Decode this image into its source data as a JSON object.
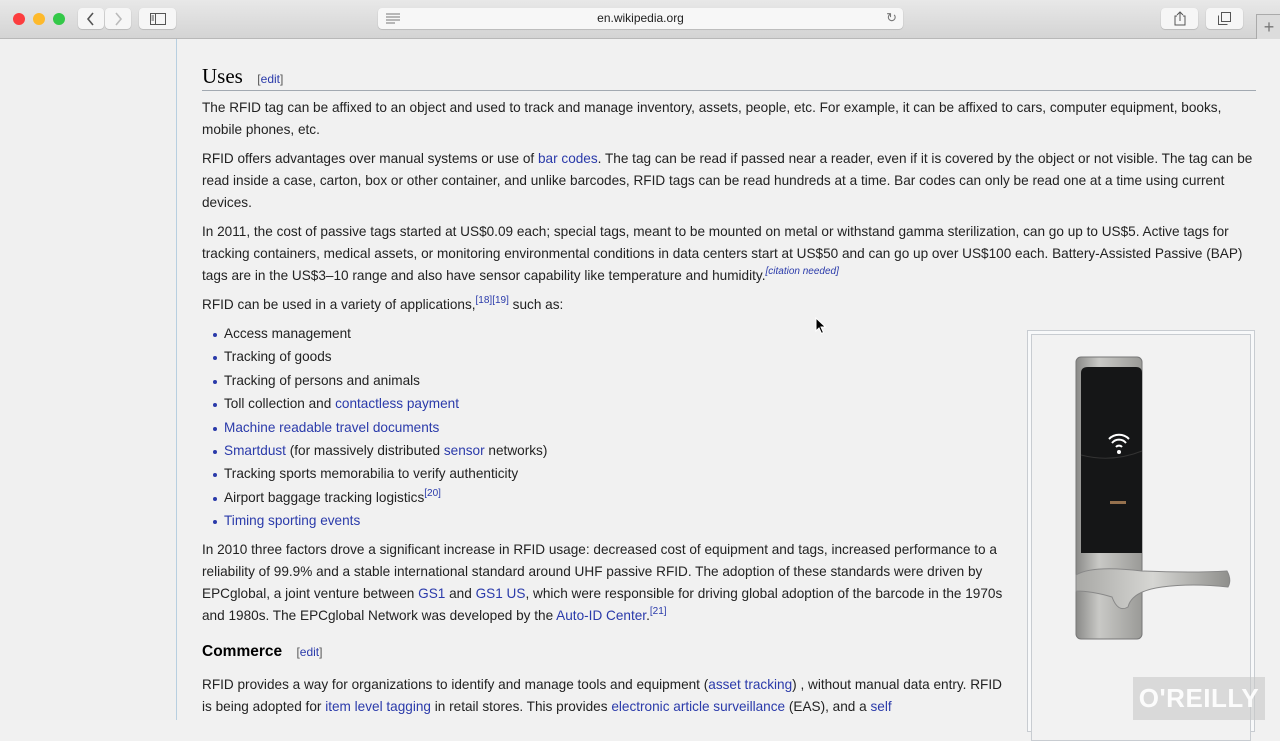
{
  "browser": {
    "url": "en.wikipedia.org",
    "icons": {
      "back": "chevron-left-icon",
      "forward": "chevron-right-icon",
      "sidebar": "sidebar-icon",
      "reader": "reader-icon",
      "reload": "reload-icon",
      "share": "share-icon",
      "tabs": "tabs-icon",
      "new_tab": "plus-icon"
    }
  },
  "article": {
    "uses": {
      "heading": "Uses",
      "edit": "edit",
      "p1": "The RFID tag can be affixed to an object and used to track and manage inventory, assets, people, etc. For example, it can be affixed to cars, computer equipment, books, mobile phones, etc.",
      "p2_a": "RFID offers advantages over manual systems or use of ",
      "p2_link": "bar codes",
      "p2_b": ". The tag can be read if passed near a reader, even if it is covered by the object or not visible. The tag can be read inside a case, carton, box or other container, and unlike barcodes, RFID tags can be read hundreds at a time. Bar codes can only be read one at a time using current devices.",
      "p3": "In 2011, the cost of passive tags started at US$0.09 each; special tags, meant to be mounted on metal or withstand gamma sterilization, can go up to US$5. Active tags for tracking containers, medical assets, or monitoring environmental conditions in data centers start at US$50 and can go up over US$100 each. Battery-Assisted Passive (BAP) tags are in the US$3–10 range and also have sensor capability like temperature and humidity.",
      "p3_cite": "citation needed",
      "p4_a": "RFID can be used in a variety of applications,",
      "p4_refs": "[18][19]",
      "p4_b": " such as:",
      "applications": [
        {
          "text": "Access management"
        },
        {
          "text": "Tracking of goods"
        },
        {
          "text": "Tracking of persons and animals"
        },
        {
          "text": "Toll collection and ",
          "link": "contactless payment"
        },
        {
          "link": "Machine readable travel documents"
        },
        {
          "link": "Smartdust",
          "text": " (for massively distributed ",
          "link2": "sensor",
          "text2": " networks)"
        },
        {
          "text": "Tracking sports memorabilia to verify authenticity"
        },
        {
          "text": "Airport baggage tracking logistics",
          "ref": "[20]"
        },
        {
          "link": "Timing sporting events"
        }
      ],
      "p5_a": "In 2010 three factors drove a significant increase in RFID usage: decreased cost of equipment and tags, increased performance to a reliability of 99.9% and a stable international standard around UHF passive RFID. The adoption of these standards were driven by EPCglobal, a joint venture between ",
      "p5_link1": "GS1",
      "p5_and": " and ",
      "p5_link2": "GS1 US",
      "p5_b": ", which were responsible for driving global adoption of the barcode in the 1970s and 1980s. The EPCglobal Network was developed by the ",
      "p5_link3": "Auto-ID Center",
      "p5_end": ".",
      "p5_ref": "[21]"
    },
    "commerce": {
      "heading": "Commerce",
      "edit": "edit",
      "p1_a": "RFID provides a way for organizations to identify and manage tools and equipment (",
      "p1_link1": "asset tracking",
      "p1_b": ") , without manual data entry. RFID is being adopted for ",
      "p1_link2": "item level tagging",
      "p1_c": " in retail stores. This provides ",
      "p1_link3": "electronic article surveillance",
      "p1_d": " (EAS), and a ",
      "p1_link4": "self"
    },
    "image": {
      "subject": "RFID hotel door lock"
    }
  },
  "watermark": "O'REILLY"
}
